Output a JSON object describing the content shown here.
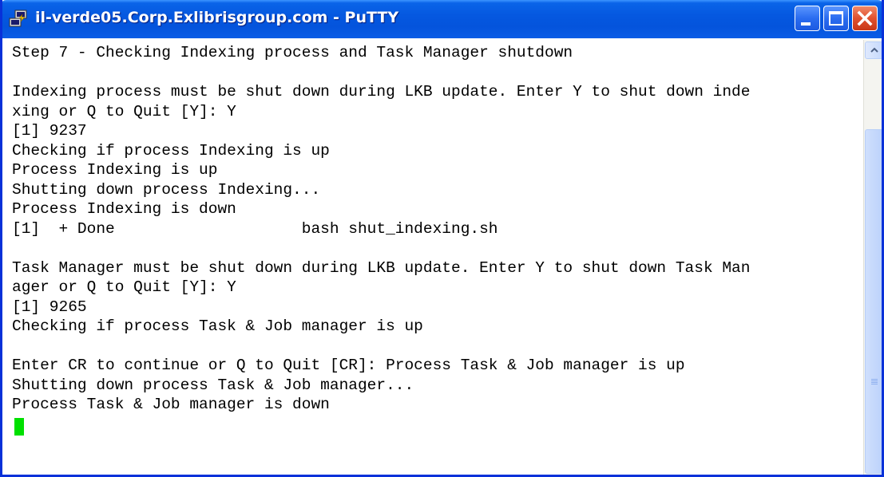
{
  "window": {
    "title": "il-verde05.Corp.Exlibrisgroup.com - PuTTY",
    "icon": "putty-icon",
    "controls": [
      "minimize-icon",
      "maximize-icon",
      "close-icon"
    ]
  },
  "terminal": {
    "lines": [
      "Step 7 - Checking Indexing process and Task Manager shutdown",
      "",
      "Indexing process must be shut down during LKB update. Enter Y to shut down inde",
      "xing or Q to Quit [Y]: Y",
      "[1] 9237",
      "Checking if process Indexing is up",
      "Process Indexing is up",
      "Shutting down process Indexing...",
      "Process Indexing is down",
      "[1]  + Done                    bash shut_indexing.sh",
      "",
      "Task Manager must be shut down during LKB update. Enter Y to shut down Task Man",
      "ager or Q to Quit [Y]: Y",
      "[1] 9265",
      "Checking if process Task & Job manager is up",
      "",
      "Enter CR to continue or Q to Quit [CR]: Process Task & Job manager is up",
      "Shutting down process Task & Job manager...",
      "Process Task & Job manager is down"
    ],
    "cursor_color": "#00e000"
  },
  "colors": {
    "titlebar": "#0558e0",
    "close_button": "#e0502e",
    "terminal_bg": "#ffffff",
    "terminal_fg": "#000000"
  }
}
